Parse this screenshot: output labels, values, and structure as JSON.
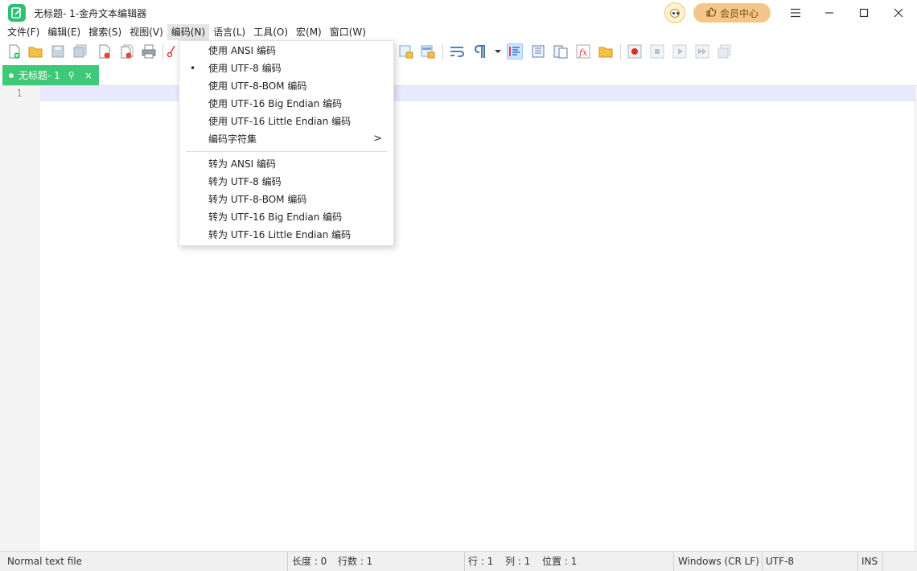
{
  "window": {
    "title": "无标题- 1-金舟文本编辑器",
    "vip_label": "会员中心"
  },
  "menu": [
    "文件(F)",
    "编辑(E)",
    "搜索(S)",
    "视图(V)",
    "编码(N)",
    "语言(L)",
    "工具(O)",
    "宏(M)",
    "窗口(W)"
  ],
  "active_menu": "编码(N)",
  "tab": {
    "label": "无标题- 1",
    "pin_icon": "pin-icon",
    "close_icon": "close-icon"
  },
  "editor": {
    "line_number": "1"
  },
  "dropdown": {
    "group1": [
      {
        "label": "使用 ANSI 编码",
        "checked": false
      },
      {
        "label": "使用 UTF-8 编码",
        "checked": true
      },
      {
        "label": "使用 UTF-8-BOM 编码",
        "checked": false
      },
      {
        "label": "使用 UTF-16 Big Endian 编码",
        "checked": false
      },
      {
        "label": "使用 UTF-16 Little Endian 编码",
        "checked": false
      },
      {
        "label": "编码字符集",
        "checked": false,
        "submenu": true
      }
    ],
    "group2": [
      {
        "label": "转为 ANSI 编码"
      },
      {
        "label": "转为 UTF-8 编码"
      },
      {
        "label": "转为 UTF-8-BOM 编码"
      },
      {
        "label": "转为 UTF-16 Big Endian 编码"
      },
      {
        "label": "转为 UTF-16 Little Endian 编码"
      }
    ],
    "check_mark": "•",
    "submenu_arrow": ">"
  },
  "status": {
    "file_type": "Normal text file",
    "length": "长度 : 0",
    "lines": "行数 : 1",
    "row": "行 : 1",
    "col": "列 : 1",
    "pos": "位置 : 1",
    "eol": "Windows (CR LF)",
    "encoding": "UTF-8",
    "mode": "INS"
  },
  "colors": {
    "tab_green": "#3ec877",
    "logo_green": "#2fbf71",
    "vip_bg": "#f4c68a",
    "current_line": "#e8e8ff"
  }
}
